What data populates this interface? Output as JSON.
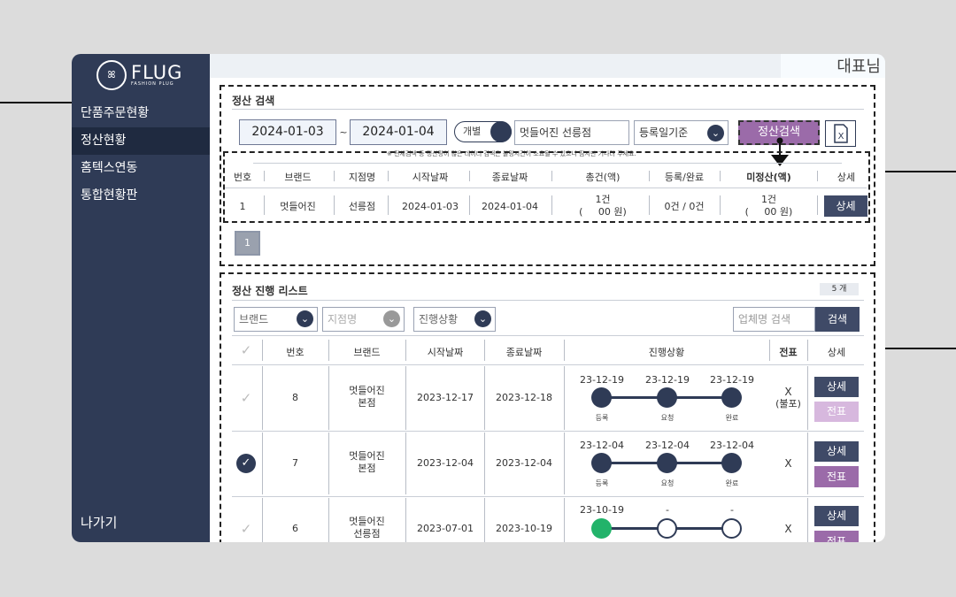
{
  "brand": {
    "logo_mark": "ꕤ",
    "name": "FLUG",
    "tagline": "FASHION PLUG"
  },
  "sidebar": {
    "items": [
      {
        "label": "단품주문현황"
      },
      {
        "label": "정산현황"
      },
      {
        "label": "홈텍스연동"
      },
      {
        "label": "통합현황판"
      }
    ],
    "exit_label": "나가기"
  },
  "header": {
    "user": "대표님"
  },
  "search_section": {
    "title": "정산 검색",
    "start_date": "2024-01-03",
    "tilde": "~",
    "end_date": "2024-01-04",
    "toggle_label": "개별",
    "store_value": "멋들어진 선릉점",
    "date_basis": "등록일기준",
    "search_button": "정산검색",
    "excel_icon": "excel-icon",
    "notice": "※ 전체검색 등 정산량이 많은 데이터 검색은 불링시간이 소요될 수 있으니 잠시만 기다려 주세요.",
    "columns": [
      "번호",
      "브랜드",
      "지점명",
      "시작날짜",
      "종료날짜",
      "총건(액)",
      "등록/완료",
      "미정산(액)",
      "상세"
    ],
    "row": {
      "no": "1",
      "brand": "멋들어진",
      "branch": "선릉점",
      "start": "2024-01-03",
      "end": "2024-01-04",
      "total_count": "1건",
      "total_amount": "(     00 원)",
      "reg_done": "0건 / 0건",
      "unsettled_count": "1건",
      "unsettled_amount": "(     00 원)",
      "detail": "상세"
    },
    "page": "1"
  },
  "progress_section": {
    "title": "정산 진행 리스트",
    "count_badge": "5 개",
    "filters": {
      "brand": "브랜드",
      "branch": "지점명",
      "status": "진행상황"
    },
    "company_placeholder": "업체명 검색",
    "search_button": "검색",
    "columns": [
      "번호",
      "브랜드",
      "시작날짜",
      "종료날짜",
      "진행상황",
      "전표",
      "상세"
    ],
    "check_icon": "✓",
    "rows": [
      {
        "no": "8",
        "brand_l1": "멋들어진",
        "brand_l2": "본점",
        "start": "2023-12-17",
        "end": "2023-12-18",
        "d1": "23-12-19",
        "d2": "23-12-19",
        "d3": "23-12-19",
        "l1": "등록",
        "l2": "요청",
        "l3": "완료",
        "slip": "X",
        "slip_note": "(불포)",
        "detail": "상세",
        "slip_btn": "전표",
        "checked": false
      },
      {
        "no": "7",
        "brand_l1": "멋들어진",
        "brand_l2": "본점",
        "start": "2023-12-04",
        "end": "2023-12-04",
        "d1": "23-12-04",
        "d2": "23-12-04",
        "d3": "23-12-04",
        "l1": "등록",
        "l2": "요청",
        "l3": "완료",
        "slip": "X",
        "slip_note": "",
        "detail": "상세",
        "slip_btn": "전표",
        "checked": true
      },
      {
        "no": "6",
        "brand_l1": "멋들어진",
        "brand_l2": "선릉점",
        "start": "2023-07-01",
        "end": "2023-10-19",
        "d1": "23-10-19",
        "d2": "-",
        "d3": "-",
        "l1": "",
        "l2": "",
        "l3": "",
        "slip": "X",
        "slip_note": "",
        "detail": "상세",
        "slip_btn": "전표",
        "checked": false
      }
    ]
  },
  "colors": {
    "navy": "#2f3b56",
    "purple": "#9b6ba9",
    "green": "#22b36a"
  }
}
